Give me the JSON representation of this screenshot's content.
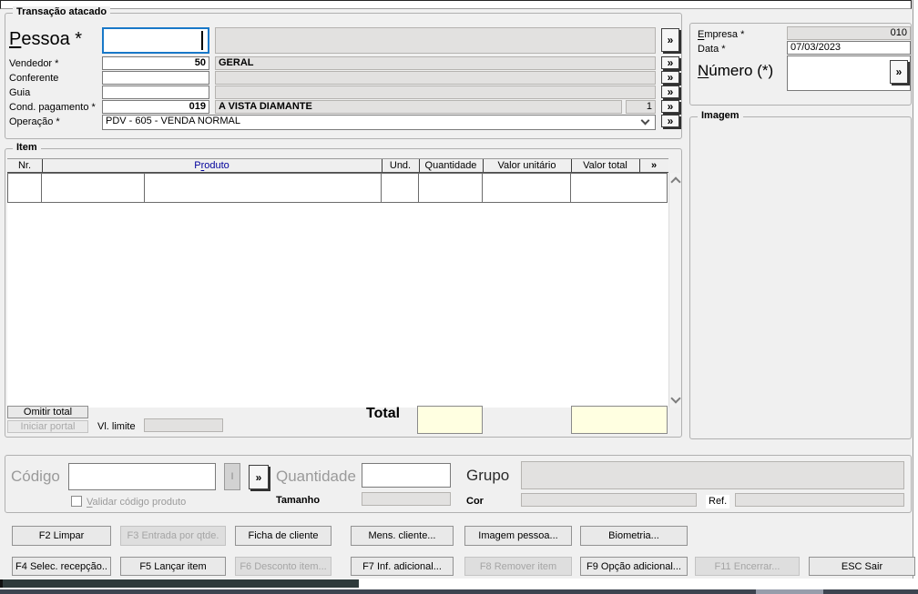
{
  "colors": {
    "focus_border": "#1878c8",
    "produto_header_text": "#00009b",
    "total_field_bg": "#ffffe1",
    "window_bg": "#f0f0f0",
    "taskbar": "#3d4450"
  },
  "transacao": {
    "title": "Transação atacado",
    "pessoa_label_u": "P",
    "pessoa_label_rest": "essoa *",
    "pessoa_value": "",
    "pessoa_display": "",
    "vendedor_label": "Vendedor *",
    "vendedor_value": "50",
    "vendedor_display": "GERAL",
    "conferente_label": "Conferente",
    "conferente_value": "",
    "conferente_display": "",
    "guia_label": "Guia",
    "guia_value": "",
    "guia_display": "",
    "cond_label": "Cond. pagamento *",
    "cond_value": "019",
    "cond_display": "A VISTA DIAMANTE",
    "cond_extra": "1",
    "operacao_label": "Operação *",
    "operacao_value": "PDV - 605 - VENDA NORMAL",
    "more": "»"
  },
  "cabecalho": {
    "empresa_label_u": "E",
    "empresa_label_rest": "mpresa *",
    "empresa_value": "010",
    "data_label": "Data *",
    "data_value": "07/03/2023",
    "numero_label_u": "N",
    "numero_label_rest": "úmero (*)",
    "numero_value": "",
    "more": "»"
  },
  "imagem": {
    "title": "Imagem"
  },
  "item": {
    "title": "Item",
    "col_nr": "Nr.",
    "col_produto_pre": "P",
    "col_produto_u": "r",
    "col_produto_rest": "oduto",
    "col_und": "Und.",
    "col_quantidade": "Quantidade",
    "col_valor_unitario": "Valor unitário",
    "col_valor_total": "Valor total",
    "col_more": "»",
    "rows": [],
    "omitir_total": "Omitir total",
    "iniciar_portal": "Iniciar portal",
    "vl_limite_label": "Vl. limite",
    "vl_limite_value": "",
    "total_label": "Total",
    "total_value_1": "",
    "total_value_2": ""
  },
  "entrada": {
    "codigo_label": "Código",
    "codigo_value": "",
    "i_button": "I",
    "more": "»",
    "validar_label_u": "V",
    "validar_label_rest": "alidar código produto",
    "quantidade_label": "Quantidade",
    "quantidade_value": "",
    "tamanho_label": "Tamanho",
    "tamanho_value": "",
    "grupo_label": "Grupo",
    "grupo_value": "",
    "cor_label": "Cor",
    "cor_value": "",
    "ref_label": "Ref.",
    "ref_value": ""
  },
  "buttons": {
    "row1": [
      {
        "label": "F2 Limpar",
        "enabled": true
      },
      {
        "label": "F3 Entrada por qtde.",
        "enabled": false
      },
      {
        "label": "Ficha de cliente",
        "enabled": true
      },
      {
        "label": "Mens. cliente...",
        "enabled": true
      },
      {
        "label": "Imagem pessoa...",
        "enabled": true
      },
      {
        "label": "Biometria...",
        "enabled": true
      }
    ],
    "row2": [
      {
        "label": "F4 Selec. recepção..",
        "enabled": true
      },
      {
        "label": "F5 Lançar item",
        "enabled": true
      },
      {
        "label": "F6 Desconto item...",
        "enabled": false
      },
      {
        "label": "F7 Inf. adicional...",
        "enabled": true
      },
      {
        "label": "F8 Remover item",
        "enabled": false
      },
      {
        "label": "F9 Opção adicional...",
        "enabled": true
      },
      {
        "label": "F11 Encerrar...",
        "enabled": false
      },
      {
        "label": "ESC Sair",
        "enabled": true
      }
    ]
  }
}
